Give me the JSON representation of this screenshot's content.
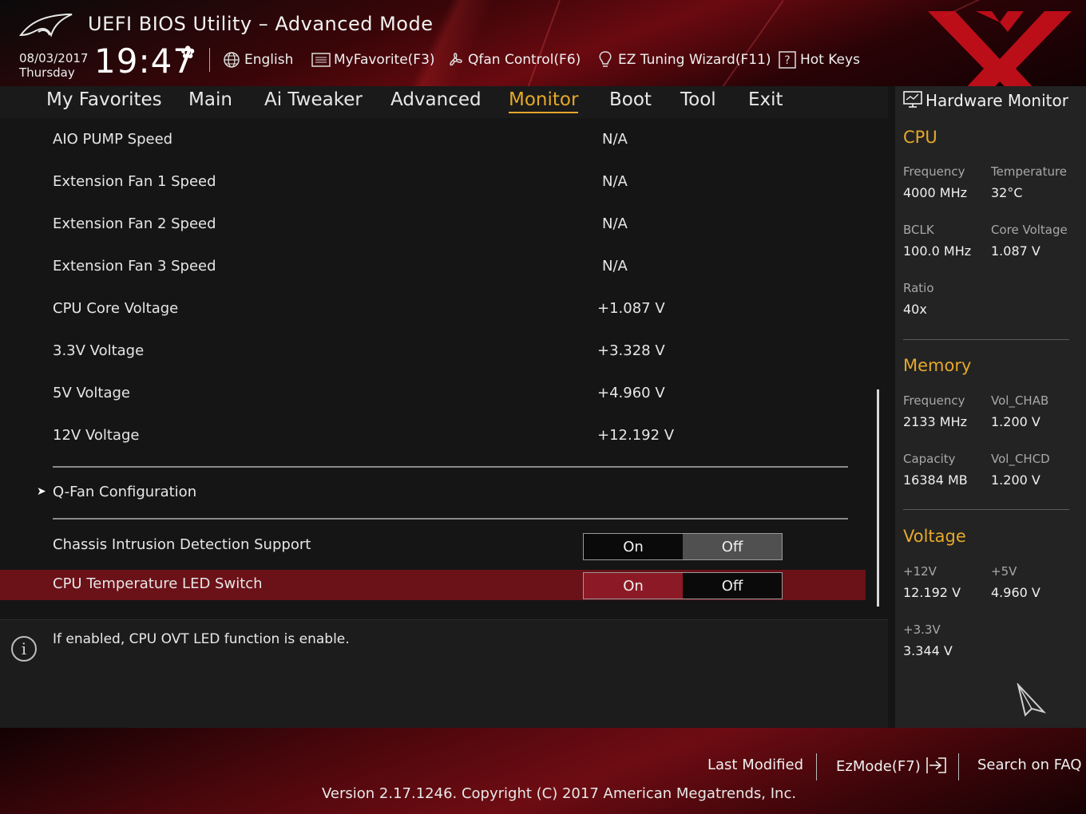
{
  "header": {
    "title": "UEFI BIOS Utility – Advanced Mode",
    "date": "08/03/2017",
    "day": "Thursday",
    "time": "19:47",
    "toolbar": [
      {
        "label": "English",
        "icon": "globe-icon"
      },
      {
        "label": "MyFavorite(F3)",
        "icon": "favorite-list-icon"
      },
      {
        "label": "Qfan Control(F6)",
        "icon": "fan-icon"
      },
      {
        "label": "EZ Tuning Wizard(F11)",
        "icon": "lightbulb-icon"
      },
      {
        "label": "Hot Keys",
        "icon": "help-box-icon"
      }
    ]
  },
  "nav": {
    "tabs": [
      "My Favorites",
      "Main",
      "Ai Tweaker",
      "Advanced",
      "Monitor",
      "Boot",
      "Tool",
      "Exit"
    ],
    "active": "Monitor"
  },
  "main": {
    "rows": [
      {
        "label": "AIO PUMP Speed",
        "value": "N/A"
      },
      {
        "label": "Extension Fan 1 Speed",
        "value": "N/A"
      },
      {
        "label": "Extension Fan 2 Speed",
        "value": "N/A"
      },
      {
        "label": "Extension Fan 3 Speed",
        "value": "N/A"
      },
      {
        "label": "CPU Core Voltage",
        "value": "+1.087 V"
      },
      {
        "label": "3.3V Voltage",
        "value": "+3.328 V"
      },
      {
        "label": "5V Voltage",
        "value": "+4.960 V"
      },
      {
        "label": "12V Voltage",
        "value": "+12.192 V"
      }
    ],
    "submenu": {
      "label": "Q-Fan Configuration"
    },
    "toggles": [
      {
        "label": "Chassis Intrusion Detection Support",
        "on": "On",
        "off": "Off",
        "selected": "On"
      },
      {
        "label": "CPU Temperature LED Switch",
        "on": "On",
        "off": "Off",
        "selected": "On"
      }
    ]
  },
  "help": {
    "text": "If enabled, CPU OVT LED function is enable."
  },
  "hardware_monitor": {
    "title": "Hardware Monitor",
    "cpu": {
      "heading": "CPU",
      "frequency_label": "Frequency",
      "frequency": "4000 MHz",
      "temperature_label": "Temperature",
      "temperature": "32°C",
      "bclk_label": "BCLK",
      "bclk": "100.0 MHz",
      "core_voltage_label": "Core Voltage",
      "core_voltage": "1.087 V",
      "ratio_label": "Ratio",
      "ratio": "40x"
    },
    "memory": {
      "heading": "Memory",
      "frequency_label": "Frequency",
      "frequency": "2133 MHz",
      "vol_chab_label": "Vol_CHAB",
      "vol_chab": "1.200 V",
      "capacity_label": "Capacity",
      "capacity": "16384 MB",
      "vol_chcd_label": "Vol_CHCD",
      "vol_chcd": "1.200 V"
    },
    "voltage": {
      "heading": "Voltage",
      "v12_label": "+12V",
      "v12": "12.192 V",
      "v5_label": "+5V",
      "v5": "4.960 V",
      "v33_label": "+3.3V",
      "v33": "3.344 V"
    }
  },
  "footer": {
    "last_modified": "Last Modified",
    "ezmode": "EzMode(F7)",
    "search_faq": "Search on FAQ",
    "version": "Version 2.17.1246. Copyright (C) 2017 American Megatrends, Inc."
  },
  "colors": {
    "accent": "#e6a82a",
    "highlight_row": "#6b1118",
    "toggle_on": "#8c1a26",
    "brand_red": "#d0101c"
  }
}
